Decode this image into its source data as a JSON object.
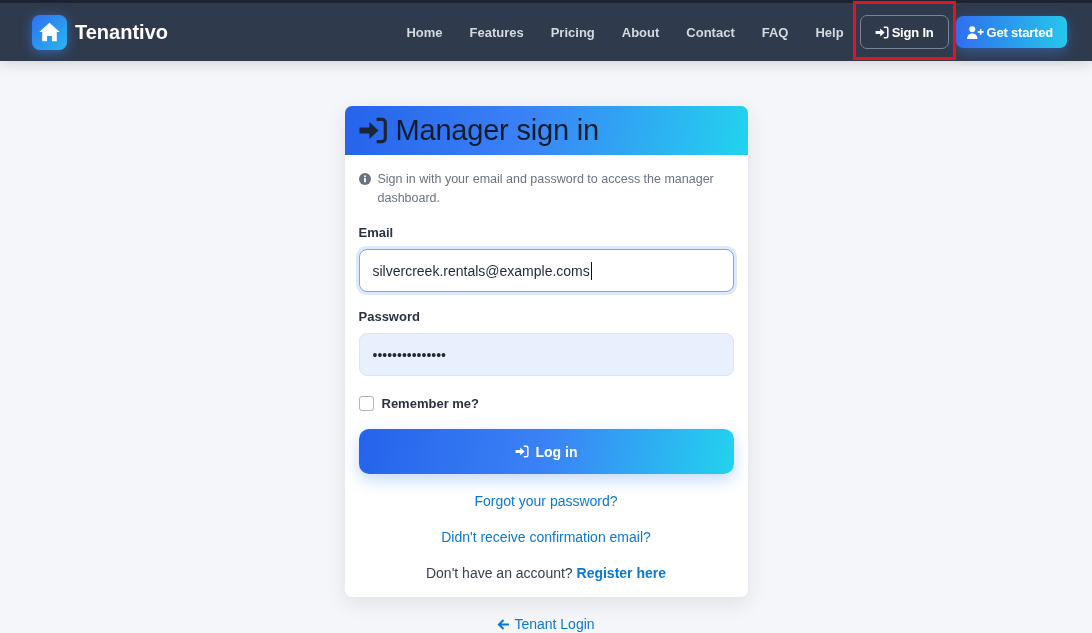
{
  "navbar": {
    "brand": "Tenantivo",
    "links": [
      {
        "label": "Home"
      },
      {
        "label": "Features"
      },
      {
        "label": "Pricing"
      },
      {
        "label": "About"
      },
      {
        "label": "Contact"
      },
      {
        "label": "FAQ"
      },
      {
        "label": "Help"
      }
    ],
    "sign_in": {
      "label": "Sign In",
      "highlighted": true
    },
    "get_started": {
      "label": "Get started"
    }
  },
  "card": {
    "title": "Manager sign in",
    "info": "Sign in with your email and password to access the manager dashboard.",
    "fields": [
      {
        "label": "Email",
        "value": "silvercreek.rentals@example.coms",
        "focused": true,
        "autofilled": false
      },
      {
        "label": "Password",
        "value": "•••••••••••••••",
        "focused": false,
        "autofilled": true
      }
    ],
    "remember": {
      "label": "Remember me?",
      "checked": false
    },
    "submit": "Log in",
    "links": [
      "Forgot your password?",
      "Didn't receive confirmation email?"
    ],
    "register": {
      "prompt": "Don't have an account?",
      "link": "Register here"
    }
  },
  "tenant_login": "Tenant Login"
}
